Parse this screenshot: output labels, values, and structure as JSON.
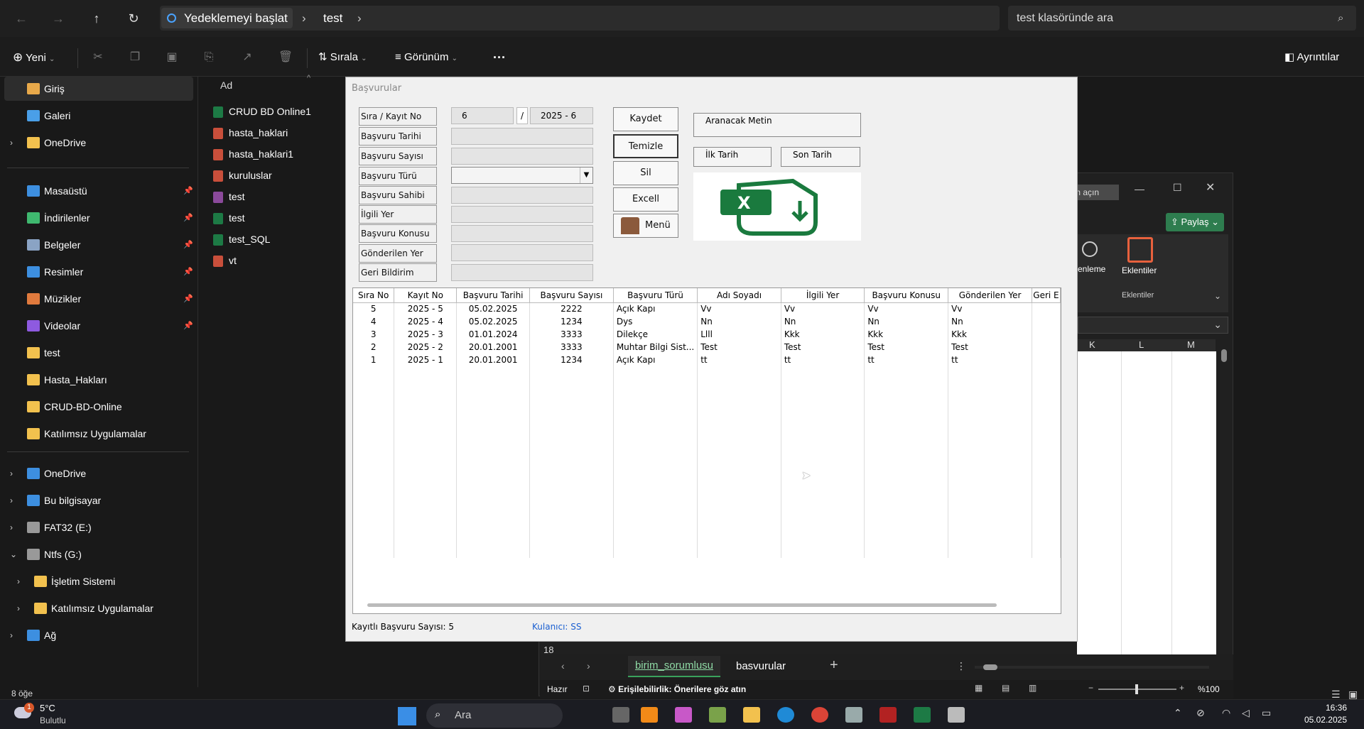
{
  "explorer": {
    "breadcrumb": [
      "Yedeklemeyi başlat",
      "test"
    ],
    "search_placeholder": "test klasöründe ara",
    "toolbar": {
      "new": "Yeni",
      "sort": "Sırala",
      "view": "Görünüm",
      "more": "···",
      "details": "Ayrıntılar"
    },
    "sidebar_top": [
      {
        "label": "Giriş",
        "color": "#e8a94a"
      },
      {
        "label": "Galeri",
        "color": "#4a9fe8"
      },
      {
        "label": "OneDrive",
        "color": "#f2c14e",
        "chev": "›"
      }
    ],
    "sidebar_pinned": [
      {
        "label": "Masaüstü",
        "color": "#3d8fe0"
      },
      {
        "label": "İndirilenler",
        "color": "#3fb86f"
      },
      {
        "label": "Belgeler",
        "color": "#8aa3c4"
      },
      {
        "label": "Resimler",
        "color": "#3d8fe0"
      },
      {
        "label": "Müzikler",
        "color": "#e07a3d"
      },
      {
        "label": "Videolar",
        "color": "#8e5ae0"
      },
      {
        "label": "test",
        "color": "#f2c14e"
      },
      {
        "label": "Hasta_Hakları",
        "color": "#f2c14e"
      },
      {
        "label": "CRUD-BD-Online",
        "color": "#f2c14e"
      },
      {
        "label": "Katılımsız Uygulamalar",
        "color": "#f2c14e"
      }
    ],
    "sidebar_bottom": [
      {
        "label": "OneDrive",
        "chev": "›",
        "color": "#3d8fe0",
        "indent": 0
      },
      {
        "label": "Bu bilgisayar",
        "chev": "›",
        "color": "#3d8fe0",
        "indent": 0
      },
      {
        "label": "FAT32 (E:)",
        "chev": "›",
        "color": "#999",
        "indent": 0
      },
      {
        "label": "Ntfs (G:)",
        "chev": "⌄",
        "color": "#999",
        "indent": 0
      },
      {
        "label": "İşletim Sistemi",
        "chev": "›",
        "color": "#f2c14e",
        "indent": 1
      },
      {
        "label": "Katılımsız Uygulamalar",
        "chev": "›",
        "color": "#f2c14e",
        "indent": 1
      },
      {
        "label": "Ağ",
        "chev": "›",
        "color": "#3d8fe0",
        "indent": 0
      }
    ],
    "column_header": "Ad",
    "files": [
      {
        "name": "CRUD BD Online1",
        "color": "#1d7a45"
      },
      {
        "name": "hasta_haklari",
        "color": "#c94f3b"
      },
      {
        "name": "hasta_haklari1",
        "color": "#c94f3b"
      },
      {
        "name": "kuruluslar",
        "color": "#c94f3b"
      },
      {
        "name": "test",
        "color": "#8b4a9b"
      },
      {
        "name": "test",
        "color": "#1d7a45"
      },
      {
        "name": "test_SQL",
        "color": "#1d7a45"
      },
      {
        "name": "vt",
        "color": "#c94f3b"
      }
    ],
    "status": "8 öğe"
  },
  "excel": {
    "share": "Paylaş",
    "addins": "Eklentiler",
    "addins_group": "Eklentiler",
    "partial": "enleme",
    "open_hint": "m açın",
    "cols": [
      "K",
      "L",
      "M"
    ],
    "row18": "18",
    "tabs": [
      "birim_sorumlusu",
      "basvurular"
    ],
    "ready": "Hazır",
    "accessibility": "Erişilebilirlik: Önerilere göz atın",
    "zoom": "%100"
  },
  "app": {
    "title": "Başvurular",
    "fields": [
      "Sıra / Kayıt No",
      "Başvuru Tarihi",
      "Başvuru Sayısı",
      "Başvuru Türü",
      "Başvuru Sahibi",
      "İlgili Yer",
      "Başvuru Konusu",
      "Gönderilen Yer",
      "Geri Bildirim"
    ],
    "sira_no": "6",
    "slash": "/",
    "kayit_no": "2025 - 6",
    "buttons": {
      "save": "Kaydet",
      "clear": "Temizle",
      "delete": "Sil",
      "excel": "Excell",
      "menu": "Menü"
    },
    "search_label": "Aranacak Metin",
    "date_first": "İlk Tarih",
    "date_last": "Son Tarih",
    "columns": [
      "Sıra No",
      "Kayıt No",
      "Başvuru Tarihi",
      "Başvuru Sayısı",
      "Başvuru Türü",
      "Adı Soyadı",
      "İlgili Yer",
      "Başvuru Konusu",
      "Gönderilen Yer",
      "Geri E"
    ],
    "rows": [
      [
        "5",
        "2025 - 5",
        "05.02.2025",
        "2222",
        "Açık Kapı",
        "Vv",
        "Vv",
        "Vv",
        "Vv"
      ],
      [
        "4",
        "2025 - 4",
        "05.02.2025",
        "1234",
        "Dys",
        "Nn",
        "Nn",
        "Nn",
        "Nn"
      ],
      [
        "3",
        "2025 - 3",
        "01.01.2024",
        "3333",
        "Dilekçe",
        "Llll",
        "Kkk",
        "Kkk",
        "Kkk"
      ],
      [
        "2",
        "2025 - 2",
        "20.01.2001",
        "3333",
        "Muhtar Bilgi Sist...",
        "Test",
        "Test",
        "Test",
        "Test"
      ],
      [
        "1",
        "2025 - 1",
        "20.01.2001",
        "1234",
        "Açık Kapı",
        "tt",
        "tt",
        "tt",
        "tt"
      ]
    ],
    "record_count": "Kayıtlı Başvuru Sayısı: 5",
    "user": "Kulanıcı: SS"
  },
  "taskbar": {
    "weather": "5°C",
    "weather_sub": "Bulutlu",
    "search": "Ara",
    "time": "16:36",
    "date": "05.02.2025",
    "badge": "1"
  }
}
